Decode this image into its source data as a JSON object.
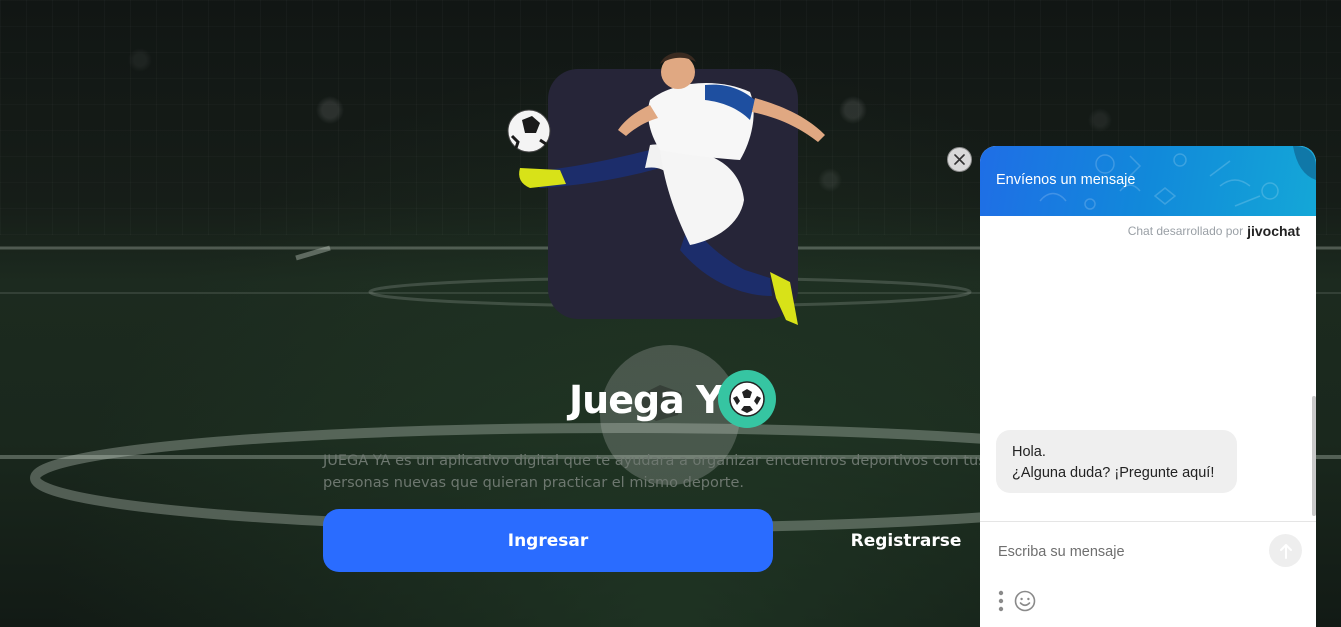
{
  "app": {
    "title": "Juega Ya",
    "title_emoji": "⚽",
    "description_lines": [
      "JUEGA YA es un aplicativo digital que te ayudara a organizar encuentros deportivos con tus amigos",
      "personas nuevas que quieran practicar el mismo deporte."
    ],
    "login_label": "Ingresar",
    "register_label": "Registrarse"
  },
  "chat": {
    "header_title": "Envíenos un mensaje",
    "powered_by": "Chat desarrollado por",
    "brand": "jivochat",
    "messages": [
      {
        "lines": [
          "Hola.",
          "¿Alguna duda? ¡Pregunte aquí!"
        ]
      }
    ],
    "input_placeholder": "Escriba su mensaje"
  },
  "colors": {
    "primary_button": "#2a6cff",
    "hero_card": "#262538",
    "title_ball_bg": "#36c5a2",
    "chat_header": "#1189da"
  },
  "icons": {
    "close": "close-icon",
    "send": "arrow-up-icon",
    "menu": "vertical-dots-icon",
    "emoji": "smiley-icon",
    "ball": "soccer-ball-icon"
  }
}
